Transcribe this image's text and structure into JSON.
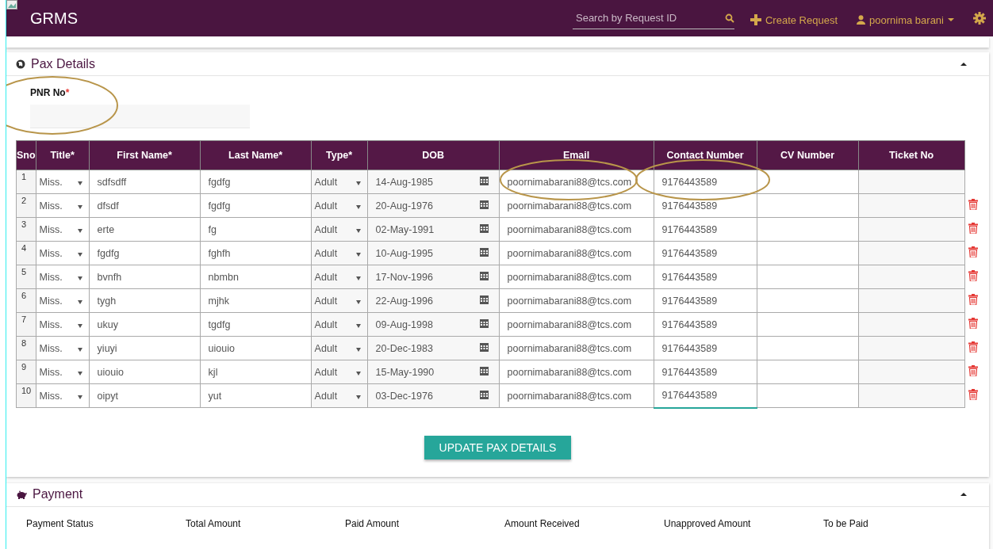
{
  "header": {
    "title": "GRMS",
    "search": {
      "placeholder": "Search by Request ID"
    },
    "create_label": "Create Request",
    "user": "poornima barani"
  },
  "pax_panel": {
    "title": "Pax Details",
    "expanded": true,
    "pnr": {
      "label": "PNR No",
      "required_mark": "*"
    },
    "table": {
      "columns": [
        "Sno",
        "Title*",
        "First Name*",
        "Last Name*",
        "Type*",
        "DOB",
        "Email",
        "Contact Number",
        "CV Number",
        "Ticket No"
      ],
      "rows": [
        {
          "sno": "1",
          "title": "Miss.",
          "first_name": "sdfsdff",
          "last_name": "fgdfg",
          "type": "Adult",
          "dob": "14-Aug-1985",
          "email": "poornimabarani88@tcs.com",
          "contact": "9176443589",
          "deletable": false,
          "focused": false
        },
        {
          "sno": "2",
          "title": "Miss.",
          "first_name": "dfsdf",
          "last_name": "fgdfg",
          "type": "Adult",
          "dob": "20-Aug-1976",
          "email": "poornimabarani88@tcs.com",
          "contact": "9176443589",
          "deletable": true,
          "focused": false
        },
        {
          "sno": "3",
          "title": "Miss.",
          "first_name": "erte",
          "last_name": "fg",
          "type": "Adult",
          "dob": "02-May-1991",
          "email": "poornimabarani88@tcs.com",
          "contact": "9176443589",
          "deletable": true,
          "focused": false
        },
        {
          "sno": "4",
          "title": "Miss.",
          "first_name": "fgdfg",
          "last_name": "fghfh",
          "type": "Adult",
          "dob": "10-Aug-1995",
          "email": "poornimabarani88@tcs.com",
          "contact": "9176443589",
          "deletable": true,
          "focused": false
        },
        {
          "sno": "5",
          "title": "Miss.",
          "first_name": "bvnfh",
          "last_name": "nbmbn",
          "type": "Adult",
          "dob": "17-Nov-1996",
          "email": "poornimabarani88@tcs.com",
          "contact": "9176443589",
          "deletable": true,
          "focused": false
        },
        {
          "sno": "6",
          "title": "Miss.",
          "first_name": "tygh",
          "last_name": "mjhk",
          "type": "Adult",
          "dob": "22-Aug-1996",
          "email": "poornimabarani88@tcs.com",
          "contact": "9176443589",
          "deletable": true,
          "focused": false
        },
        {
          "sno": "7",
          "title": "Miss.",
          "first_name": "ukuy",
          "last_name": "tgdfg",
          "type": "Adult",
          "dob": "09-Aug-1998",
          "email": "poornimabarani88@tcs.com",
          "contact": "9176443589",
          "deletable": true,
          "focused": false
        },
        {
          "sno": "8",
          "title": "Miss.",
          "first_name": "yiuyi",
          "last_name": "uiouio",
          "type": "Adult",
          "dob": "20-Dec-1983",
          "email": "poornimabarani88@tcs.com",
          "contact": "9176443589",
          "deletable": true,
          "focused": false
        },
        {
          "sno": "9",
          "title": "Miss.",
          "first_name": "uiouio",
          "last_name": "kjl",
          "type": "Adult",
          "dob": "15-May-1990",
          "email": "poornimabarani88@tcs.com",
          "contact": "9176443589",
          "deletable": true,
          "focused": false
        },
        {
          "sno": "10",
          "title": "Miss.",
          "first_name": "oipyt",
          "last_name": "yut",
          "type": "Adult",
          "dob": "03-Dec-1976",
          "email": "poornimabarani88@tcs.com",
          "contact": "9176443589",
          "deletable": true,
          "focused": true
        }
      ]
    },
    "update_button": "UPDATE PAX DETAILS"
  },
  "payment_panel": {
    "title": "Payment",
    "expanded": true,
    "columns": [
      "Payment Status",
      "Total Amount",
      "Paid Amount",
      "Amount Received",
      "Unapproved Amount",
      "To be Paid"
    ]
  },
  "annotations": [
    {
      "kind": "ellipse"
    },
    {
      "kind": "ellipse"
    },
    {
      "kind": "ellipse"
    }
  ]
}
